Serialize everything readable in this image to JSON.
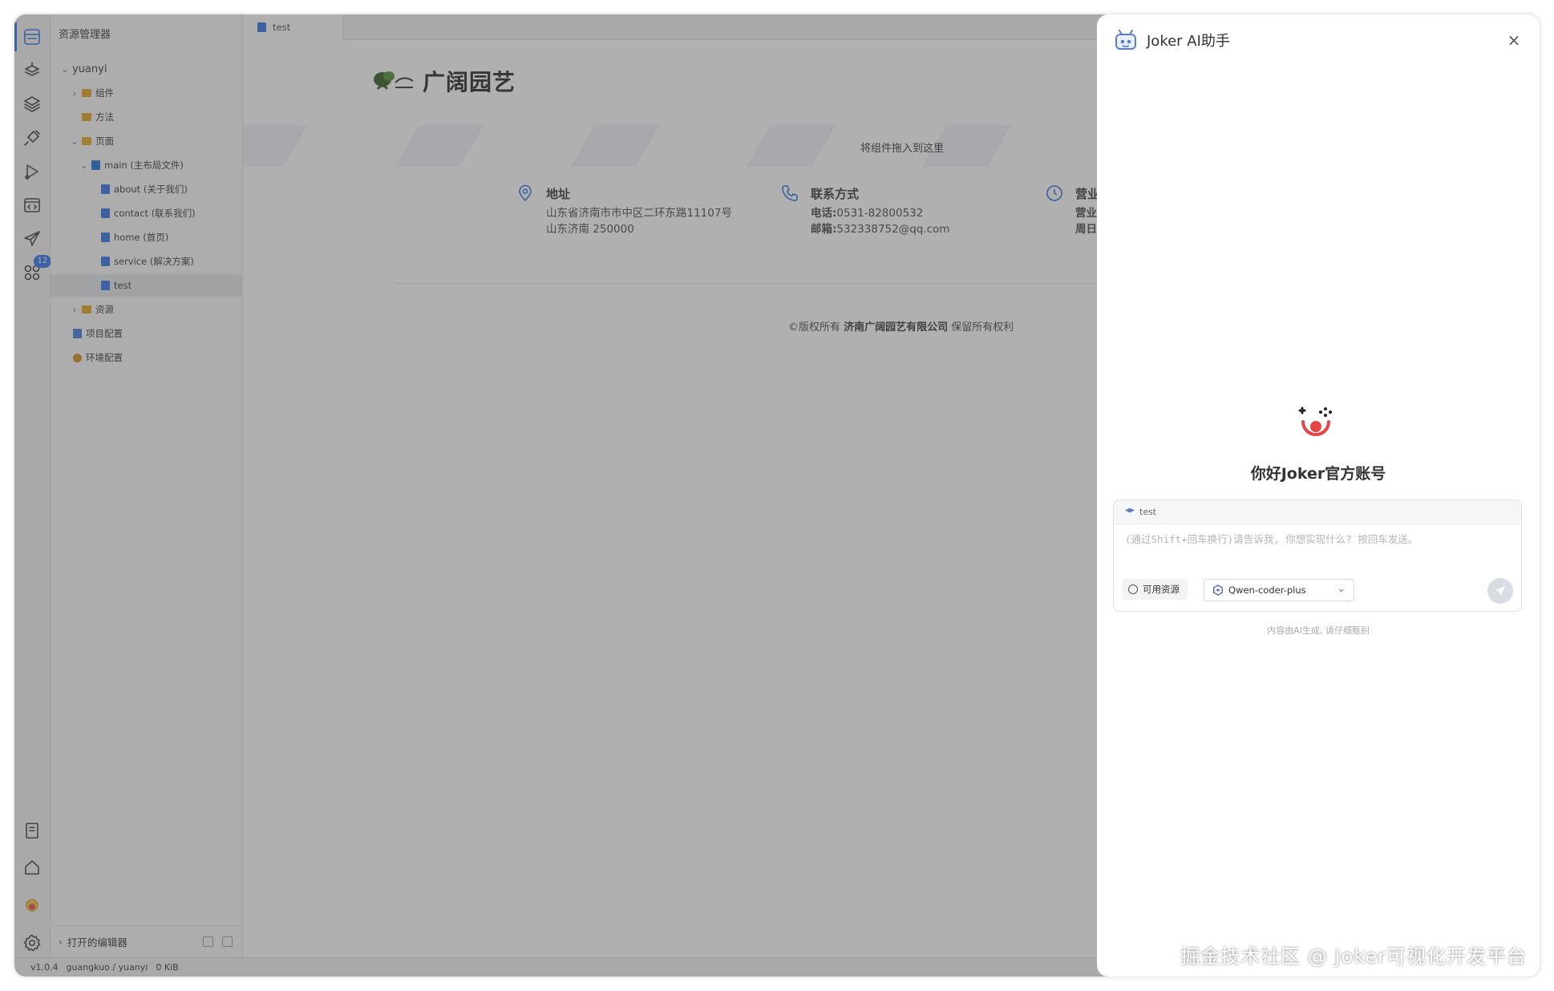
{
  "explorer": {
    "title": "资源管理器",
    "root": "yuanyi",
    "items": [
      {
        "label": "组件"
      },
      {
        "label": "方法"
      },
      {
        "label": "页面"
      },
      {
        "label": "main (主布局文件)"
      },
      {
        "label": "about (关于我们)"
      },
      {
        "label": "contact (联系我们)"
      },
      {
        "label": "home (首页)"
      },
      {
        "label": "service (解决方案)"
      },
      {
        "label": "test"
      },
      {
        "label": "资源"
      },
      {
        "label": "项目配置"
      },
      {
        "label": "环境配置"
      }
    ],
    "open_editors": "打开的编辑器"
  },
  "activity": {
    "badge": "12"
  },
  "tabs": [
    {
      "label": "test"
    }
  ],
  "canvas": {
    "logo_text": "广阔园艺",
    "drop_hint": "将组件拖入到这里",
    "address": {
      "title": "地址",
      "line1": "山东省济南市市中区二环东路11107号",
      "line2": "山东济南 250000"
    },
    "contact": {
      "title": "联系方式",
      "phone_label": "电话:",
      "phone": "0531-82800532",
      "email_label": "邮箱:",
      "email": "532338752@qq.com"
    },
    "hours": {
      "title": "营业时",
      "line1": "营业时",
      "line2": "周日:正"
    },
    "copyright_prefix": "©版权所有 ",
    "copyright_company": "济南广阔园艺有限公司",
    "copyright_suffix": " 保留所有权利"
  },
  "status": {
    "version": "v1.0.4",
    "repo": "guangkuo / yuanyi",
    "size": "0 KiB"
  },
  "ai": {
    "title": "Joker AI助手",
    "greeting": "你好Joker官方账号",
    "context_tag": "test",
    "placeholder": "(通过Shift+回车换行)请告诉我, 你想实现什么? 按回车发送。",
    "resources_label": "可用资源",
    "model": "Qwen-coder-plus",
    "disclaimer": "内容由AI生成, 请仔细甄别"
  },
  "watermark": "掘金技术社区 @ Joker可视化开发平台",
  "colors": {
    "accent": "#2f6fe4",
    "folder": "#e8a51a"
  }
}
